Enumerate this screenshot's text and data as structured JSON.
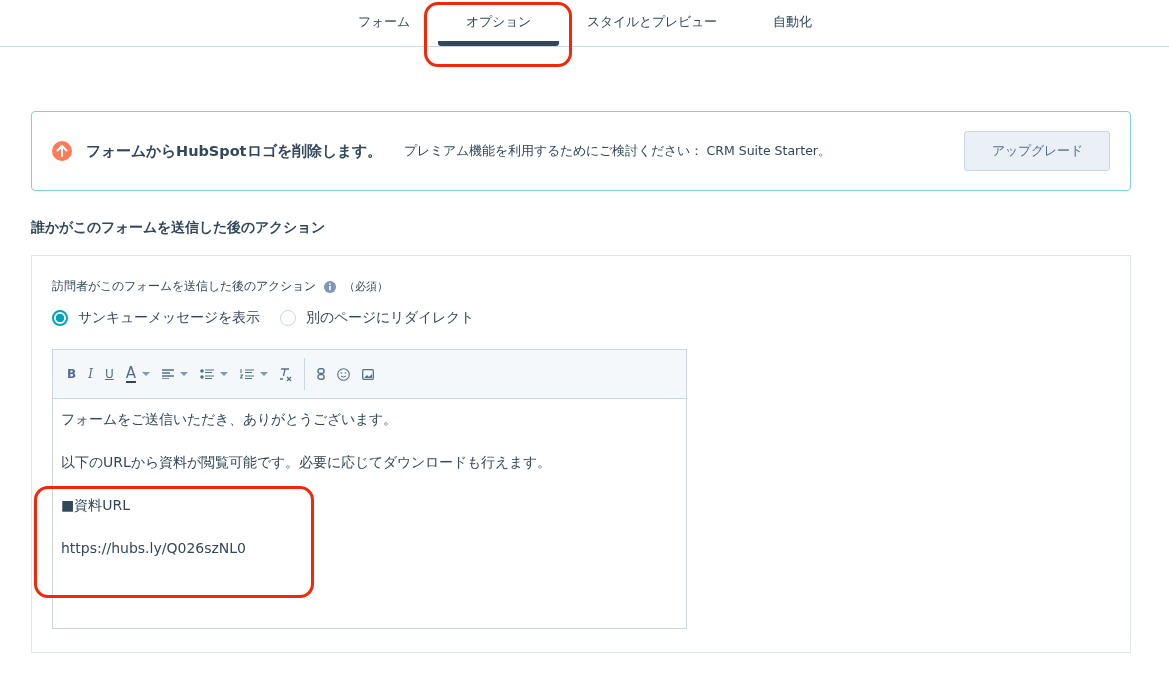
{
  "tabs": [
    {
      "label": "フォーム",
      "selected": false
    },
    {
      "label": "オプション",
      "selected": true
    },
    {
      "label": "スタイルとプレビュー",
      "selected": false
    },
    {
      "label": "自動化",
      "selected": false
    }
  ],
  "banner": {
    "title": "フォームからHubSpotロゴを削除します。",
    "text": "プレミアム機能を利用するためにご検討ください： CRM Suite Starter。",
    "button": "アップグレード"
  },
  "section_title": "誰かがこのフォームを送信した後のアクション",
  "field": {
    "label": "訪問者がこのフォームを送信した後のアクション",
    "required": "（必須）",
    "options": [
      {
        "label": "サンキューメッセージを表示",
        "selected": true
      },
      {
        "label": "別のページにリダイレクト",
        "selected": false
      }
    ]
  },
  "editor": {
    "toolbar_letters": [
      "B",
      "I",
      "U",
      "A"
    ],
    "paragraphs": [
      "フォームをご送信いただき、ありがとうございます。",
      "以下のURLから資料が閲覧可能です。必要に応じてダウンロードも行えます。",
      "■資料URL",
      "https://hubs.ly/Q026szNL0"
    ]
  }
}
